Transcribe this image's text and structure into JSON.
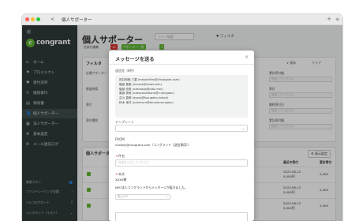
{
  "window": {
    "back_label": "<",
    "title": "個人サポーター",
    "new_tab_icon": "+",
    "menu_icon": "≡"
  },
  "sidebar": {
    "top_label": "組",
    "logo": "congrant",
    "items": [
      {
        "icon": "home-icon",
        "glyph": "⌂",
        "label": "ホーム"
      },
      {
        "icon": "flag-icon",
        "glyph": "⚑",
        "label": "プロジェクト"
      },
      {
        "icon": "heart-icon",
        "glyph": "♥",
        "label": "寄付決済"
      },
      {
        "icon": "refresh-icon",
        "glyph": "↻",
        "label": "継続寄付"
      },
      {
        "icon": "receipt-icon",
        "glyph": "▤",
        "label": "領収書"
      },
      {
        "icon": "person-icon",
        "glyph": "👤",
        "label": "個人サポーター"
      },
      {
        "icon": "building-icon",
        "glyph": "▦",
        "label": "法人サポーター"
      },
      {
        "icon": "gear-icon",
        "glyph": "⚙",
        "label": "基本設定"
      },
      {
        "icon": "mail-icon",
        "glyph": "✉",
        "label": "メール送信ログ"
      }
    ],
    "footer": [
      {
        "label": "新規プラン",
        "icon": "users-icon",
        "glyph": "👥"
      },
      {
        "label": "ファンドレイジング支援",
        "icon": "chevron-right-icon",
        "glyph": "›"
      },
      {
        "label": "ヘルプ&サポート",
        "icon": "help-icon",
        "glyph": "?"
      },
      {
        "label": "コングラント（テスト）",
        "icon": "chevron-down-icon",
        "glyph": "⌄"
      }
    ]
  },
  "main": {
    "title": "個人サポーター",
    "search_placeholder": "フリー検索",
    "filter_label": "▼ フィルタ",
    "chips": [
      "名前を編集",
      "12",
      "サポーター一覧",
      "1"
    ],
    "filter_card": {
      "title": "フィルタ",
      "right_labels": [
        "∨ 保存",
        "クリア"
      ],
      "fields": [
        "広場サポーター",
        "都道府県",
        "寄付",
        "寄付種別",
        "累計寄付額",
        "寄付",
        "最終寄付日",
        "累計寄付額"
      ],
      "placeholder": "指定してください"
    },
    "list_card": {
      "title": "個人サポーター",
      "settings_button": "⚙ 表示設定",
      "headers": [
        "最近の寄付",
        "累計寄付"
      ],
      "rows": [
        {
          "date": "2023-08-23",
          "amount": "5,000円",
          "total": "5,000"
        },
        {
          "date": "2023-08-13",
          "amount": "5,000円",
          "total": "5,000"
        },
        {
          "date": "2023-08-23",
          "amount": "5,000円",
          "total": "5,000"
        }
      ]
    }
  },
  "modal": {
    "title": "メッセージを送る",
    "close_icon": "×",
    "recipients_label": "送信先（6件）",
    "recipients": [
      "田井和哉 三菱 (mosoichiko@chosigate.com)",
      "磯部 直美 (utsuna@nowd.com)",
      "磯部 亮秀 (nakoraga@nda.men)",
      "服部 秀美 (nakoyonatbono@n.serigabu)",
      "吉川 直美 (ayass@tozugatsu.katoh)",
      "鈴木 幸村 (yukimura@tonoda.songoku)"
    ],
    "template_label": "テンプレート",
    "from_label": "FROM",
    "from_value": "noreply@congrant.com（コングラント［送信専用］）",
    "subject_label": "件名",
    "subject_placeholder": "件名を入力してください",
    "body_label": "本文",
    "body_lines": [
      "XXXX様",
      "NPO法人コングラントからメッセージが届きました。"
    ],
    "insert_tag_placeholder": "差込タグ"
  }
}
